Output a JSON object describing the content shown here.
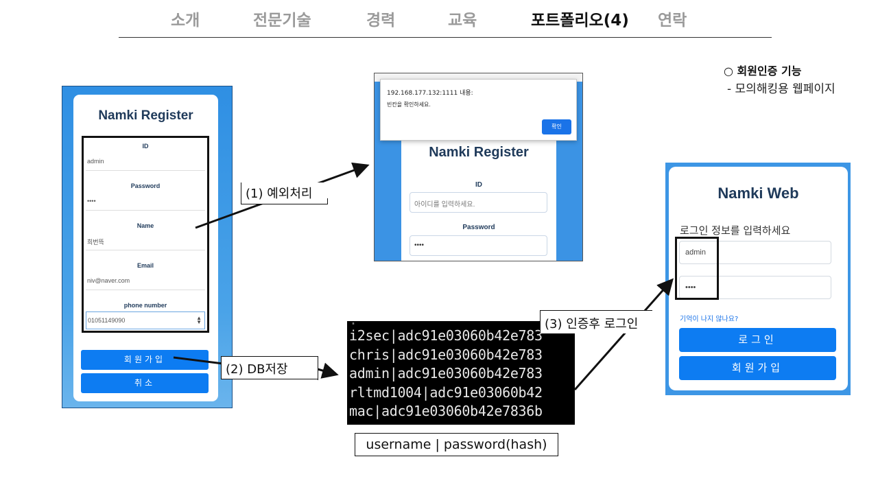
{
  "nav": {
    "items": [
      {
        "label": "소개"
      },
      {
        "label": "전문기술"
      },
      {
        "label": "경력"
      },
      {
        "label": "교육"
      },
      {
        "label": "포트폴리오(4)"
      },
      {
        "label": "연락"
      }
    ],
    "active_index": 4
  },
  "feature": {
    "title": "○ 회원인증 기능",
    "subtitle": "- 모의해킹용 웹페이지"
  },
  "register_shot": {
    "title": "Namki Register",
    "fields": [
      {
        "label": "ID",
        "value": "admin"
      },
      {
        "label": "Password",
        "value": "••••"
      },
      {
        "label": "Name",
        "value": "희번뜩"
      },
      {
        "label": "Email",
        "value": "niv@naver.com"
      },
      {
        "label": "phone number",
        "value": "01051149090"
      }
    ],
    "signup_label": "회원가입",
    "cancel_label": "취소"
  },
  "alert_shot": {
    "host": "192.168.177.132:1111 내용:",
    "message": "빈칸을 확인하세요.",
    "ok_label": "확인",
    "form_title": "Namki Register",
    "id_label": "ID",
    "id_placeholder": "아이디를 입력하세요.",
    "password_label": "Password",
    "password_value": "••••"
  },
  "login_shot": {
    "title": "Namki Web",
    "hint": "로그인 정보를 입력하세요",
    "id_value": "admin",
    "password_value": "••••",
    "forgot": "기억이 나지 않나요?",
    "login_label": "로그인",
    "signup_label": "회원가입"
  },
  "annotations": {
    "step1": "(1) 예외처리",
    "step2": "(2) DB저장",
    "step3": "(3) 인증후 로그인"
  },
  "terminal": {
    "lines": [
      "i2sec|adc91e03060b42e783",
      "chris|adc91e03060b42e783",
      "admin|adc91e03060b42e783",
      "rltmd1004|adc91e03060b42",
      "mac|adc91e03060b42e7836b"
    ],
    "caption": "username | password(hash)"
  }
}
